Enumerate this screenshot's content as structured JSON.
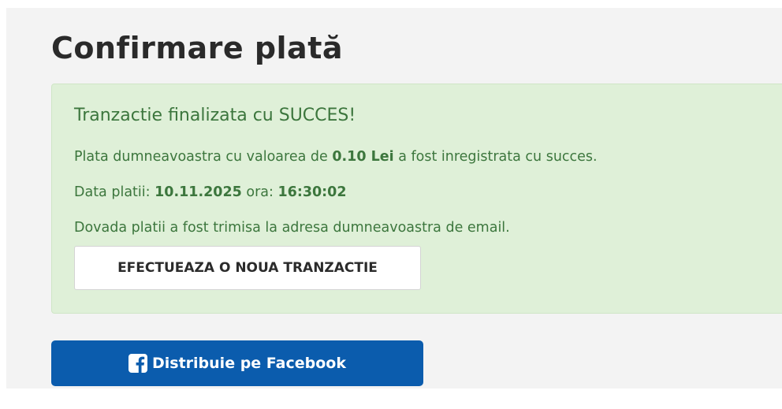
{
  "page": {
    "title": "Confirmare plată"
  },
  "alert": {
    "heading": "Tranzactie finalizata cu SUCCES!",
    "line1_prefix": "Plata dumneavoastra cu valoarea de ",
    "amount": "0.10 Lei",
    "line1_suffix": " a fost inregistrata cu succes.",
    "date_label": "Data platii: ",
    "date": "10.11.2025",
    "time_label": " ora: ",
    "time": "16:30:02",
    "line3": "Dovada platii a fost trimisa la adresa dumneavoastra de email.",
    "new_transaction_button": "EFECTUEAZA O NOUA TRANZACTIE"
  },
  "share": {
    "facebook_button": "Distribuie pe Facebook",
    "icon": "facebook-icon"
  },
  "colors": {
    "page_background": "#f3f3f3",
    "alert_background": "#dff0d8",
    "alert_text": "#3c763d",
    "facebook_button": "#0b5cad"
  }
}
